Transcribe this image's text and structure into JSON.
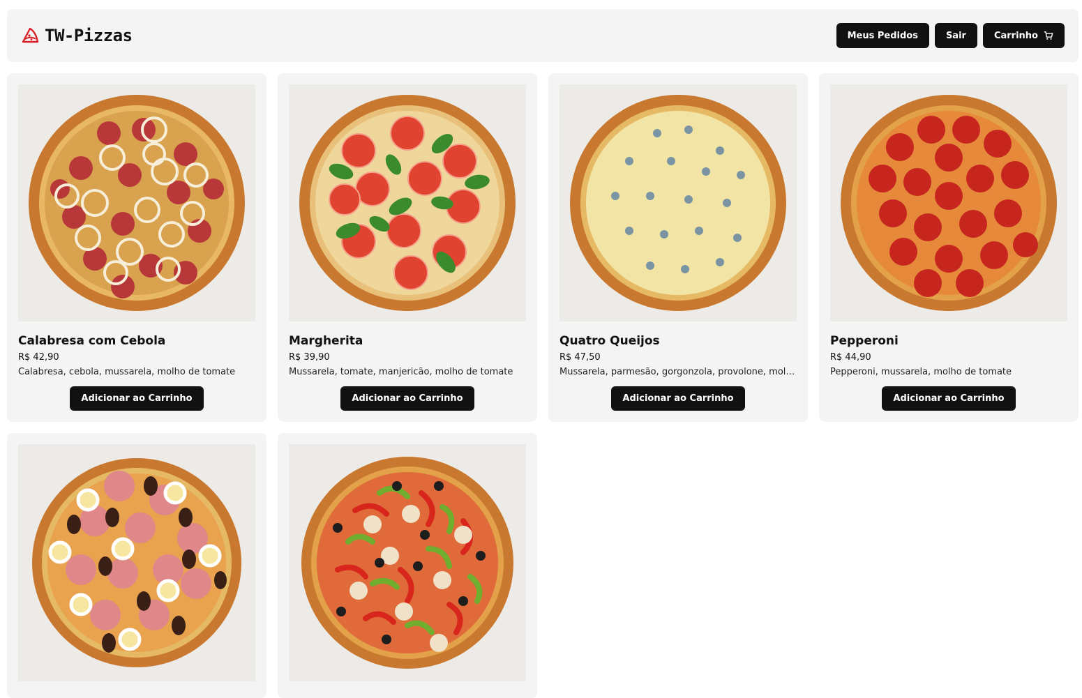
{
  "brand": {
    "name": "TW-Pizzas",
    "icon": "pizza-slice-icon",
    "accent": "#d92027"
  },
  "nav": {
    "orders_label": "Meus Pedidos",
    "logout_label": "Sair",
    "cart_label": "Carrinho",
    "cart_icon": "cart-icon"
  },
  "products": [
    {
      "name": "Calabresa com Cebola",
      "price": "R$ 42,90",
      "description": "Calabresa, cebola, mussarela, molho de tomate",
      "button": "Adicionar ao Carrinho"
    },
    {
      "name": "Margherita",
      "price": "R$ 39,90",
      "description": "Mussarela, tomate, manjericão, molho de tomate",
      "button": "Adicionar ao Carrinho"
    },
    {
      "name": "Quatro Queijos",
      "price": "R$ 47,50",
      "description": "Mussarela, parmesão, gorgonzola, provolone, molho de tomate",
      "button": "Adicionar ao Carrinho"
    },
    {
      "name": "Pepperoni",
      "price": "R$ 44,90",
      "description": "Pepperoni, mussarela, molho de tomate",
      "button": "Adicionar ao Carrinho"
    }
  ],
  "colors": {
    "button_bg": "#111111",
    "card_bg": "#f4f4f5",
    "header_bg": "#f4f4f5"
  }
}
